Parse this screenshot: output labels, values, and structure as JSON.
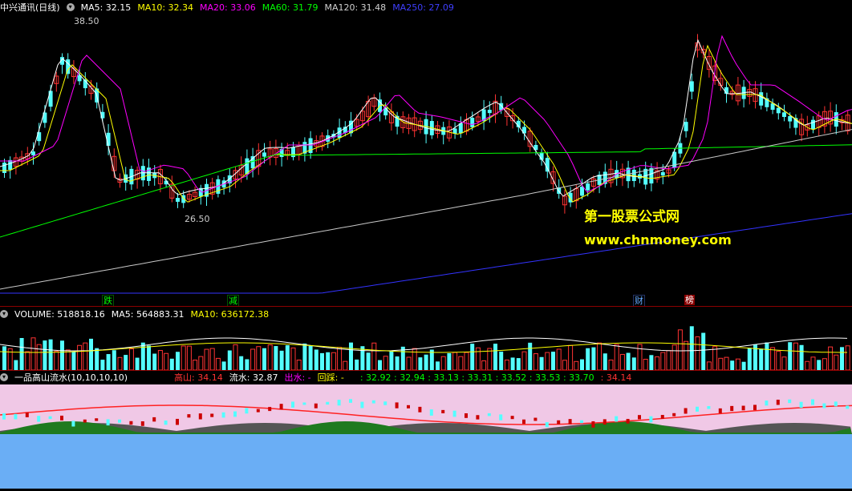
{
  "main_header": {
    "title": "中兴通讯(日线)",
    "ma5": "MA5: 32.15",
    "ma10": "MA10: 32.34",
    "ma20": "MA20: 33.06",
    "ma60": "MA60: 31.79",
    "ma120": "MA120: 31.48",
    "ma250": "MA250: 27.09"
  },
  "price_labels": {
    "high": "38.50",
    "low": "26.50"
  },
  "badges": {
    "b1": "跌",
    "b2": "减",
    "b3": "财",
    "b4": "榜"
  },
  "watermark": {
    "line1": "第一股票公式网",
    "line2": "www.chnmoney.com"
  },
  "volume_header": {
    "volume": "VOLUME: 518818.16",
    "ma5": "MA5: 564883.31",
    "ma10": "MA10: 636172.38"
  },
  "indicator_header": {
    "name": "一品高山流水(10,10,10,10)",
    "gaoshan": "高山: 34.14",
    "liushui": "流水: 32.87",
    "chushui": "出水: -",
    "huicai": "回踩: -",
    "values": ": 32.92 : 32.94 : 33.13 : 33.31 : 33.52 : 33.53 : 33.70",
    "last": ": 34.14"
  },
  "colors": {
    "ma5": "#ffffff",
    "ma10": "#ffff00",
    "ma20": "#ff00ff",
    "ma60": "#00ff00",
    "ma120": "#c8c8c8",
    "ma250": "#3333ff",
    "up": "#ff3333",
    "down": "#54ffff"
  }
}
